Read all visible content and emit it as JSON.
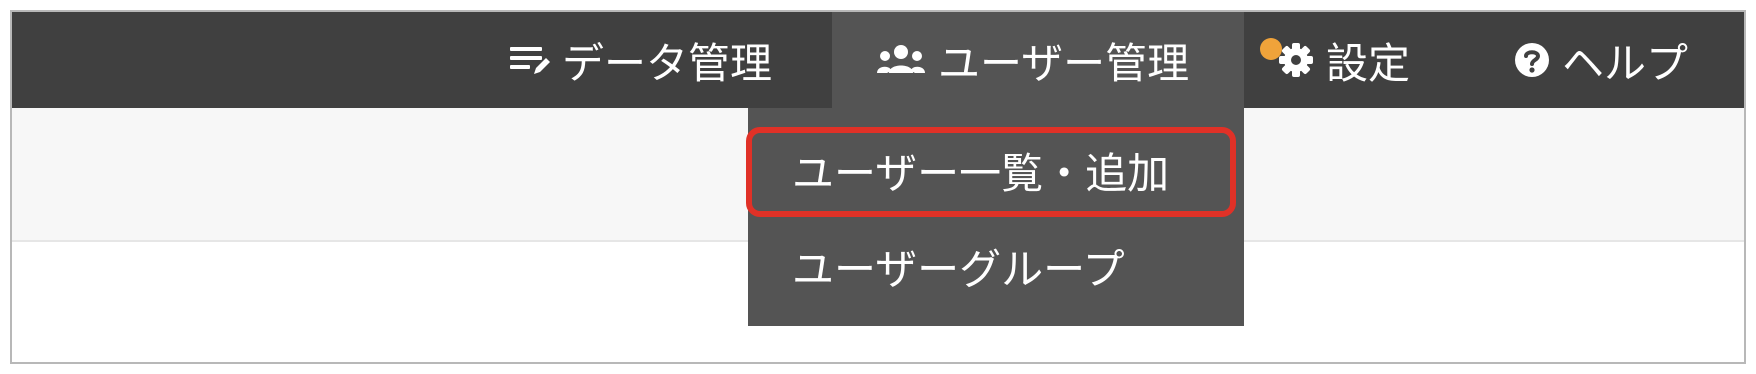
{
  "navbar": {
    "items": [
      {
        "label": "データ管理",
        "icon": "data-edit-icon"
      },
      {
        "label": "ユーザー管理",
        "icon": "users-icon",
        "active": true
      },
      {
        "label": "設定",
        "icon": "gear-icon",
        "notification_dot": true
      },
      {
        "label": "ヘルプ",
        "icon": "help-circle-icon"
      }
    ]
  },
  "dropdown": {
    "items": [
      {
        "label": "ユーザー一覧・追加",
        "highlighted": true
      },
      {
        "label": "ユーザーグループ"
      }
    ]
  },
  "colors": {
    "navbar_bg": "#404040",
    "active_bg": "#545454",
    "highlight_border": "#e03127",
    "notification_dot": "#f0a33a",
    "subbar_bg": "#f7f7f7"
  }
}
